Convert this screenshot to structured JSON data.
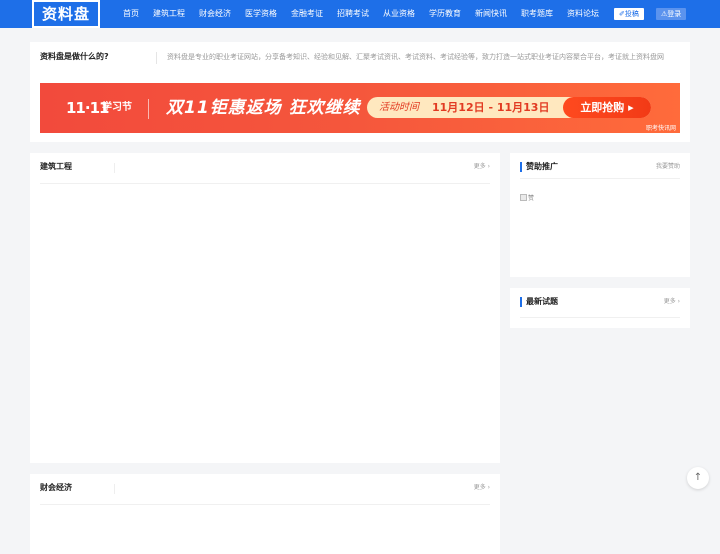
{
  "header": {
    "logo": "资料盘",
    "nav": [
      "首页",
      "建筑工程",
      "财会经济",
      "医学资格",
      "金融考证",
      "招聘考试",
      "从业资格",
      "学历教育",
      "新闻快讯",
      "职考题库",
      "资料论坛"
    ],
    "submit_label": "✐投稿",
    "login_label": "⚠登录"
  },
  "about": {
    "title": "资料盘是做什么的?",
    "desc": "资料盘是专业的职业考证网站，分享备考知识、经验和见解、汇聚考试资讯、考试资料、考试经验等，致力打造一站式职业考证内容聚合平台，考证就上资料盘网"
  },
  "banner": {
    "event": "11·11",
    "event_sub": "学习节",
    "headline": "双11钜惠返场 狂欢继续",
    "time_label": "活动时间",
    "time_range": "11月12日 - 11月13日",
    "cta": "立即抢购 ▸",
    "source": "职考快讯网"
  },
  "sections": {
    "jianzhu": {
      "title": "建筑工程",
      "more": "更多 ›"
    },
    "caikuai": {
      "title": "财会经济",
      "more": "更多 ›"
    },
    "sponsor": {
      "title": "赞助推广",
      "more": "我要赞助",
      "img_alt": "赞"
    },
    "latest": {
      "title": "最新试题",
      "more": "更多 ›"
    }
  },
  "totop_icon": "↑"
}
